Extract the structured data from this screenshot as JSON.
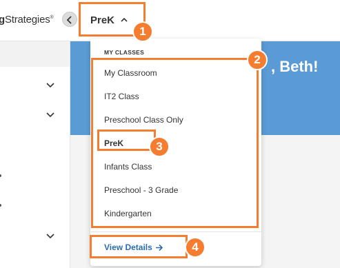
{
  "header": {
    "brand_bold": "g",
    "brand_rest": "Strategies",
    "brand_mark": "®",
    "class_switcher_label": "PreK"
  },
  "hero": {
    "greeting": ", Beth!"
  },
  "dropdown": {
    "section_title": "MY CLASSES",
    "items": [
      {
        "label": "My Classroom",
        "active": false
      },
      {
        "label": "IT2 Class",
        "active": false
      },
      {
        "label": "Preschool Class Only",
        "active": false
      },
      {
        "label": "PreK",
        "active": true
      },
      {
        "label": "Infants Class",
        "active": false
      },
      {
        "label": "Preschool - 3 Grade",
        "active": false
      },
      {
        "label": "Kindergarten",
        "active": false
      }
    ],
    "view_details_label": "View Details"
  },
  "callouts": [
    "1",
    "2",
    "3",
    "4"
  ],
  "colors": {
    "accent_orange": "#f47d30",
    "hero_blue": "#5b9bd5",
    "link_blue": "#2b6cb0"
  },
  "icons": [
    "chevron-left-icon",
    "chevron-up-icon",
    "chevron-down-icon",
    "arrow-right-icon"
  ]
}
